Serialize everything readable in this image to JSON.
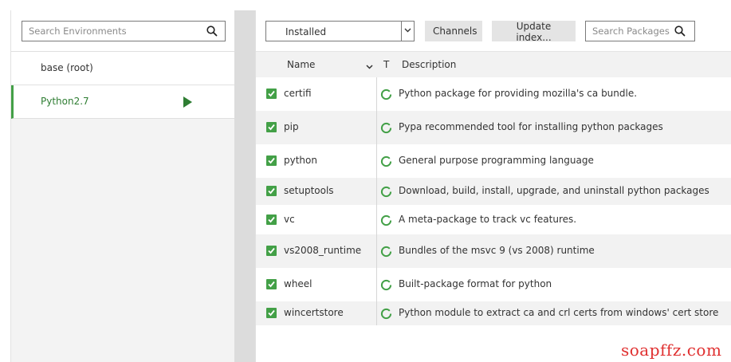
{
  "environments": {
    "search_placeholder": "Search Environments",
    "items": [
      {
        "label": "base (root)",
        "active": false
      },
      {
        "label": "Python2.7",
        "active": true
      }
    ]
  },
  "toolbar": {
    "filter_value": "Installed",
    "channels_label": "Channels",
    "update_label": "Update index...",
    "search_placeholder": "Search Packages"
  },
  "table": {
    "headers": {
      "name": "Name",
      "type": "T",
      "description": "Description"
    },
    "rows": [
      {
        "name": "certifi",
        "description": "Python package for providing mozilla's ca bundle."
      },
      {
        "name": "pip",
        "description": "Pypa recommended tool for installing python packages"
      },
      {
        "name": "python",
        "description": "General purpose programming language"
      },
      {
        "name": "setuptools",
        "description": "Download, build, install, upgrade, and uninstall python packages"
      },
      {
        "name": "vc",
        "description": "A meta-package to track vc features."
      },
      {
        "name": "vs2008_runtime",
        "description": "Bundles of the msvc 9 (vs 2008) runtime"
      },
      {
        "name": "wheel",
        "description": "Built-package format for python"
      },
      {
        "name": "wincertstore",
        "description": "Python module to extract ca and crl certs from windows' cert store"
      }
    ]
  },
  "watermark": "soapffz.com",
  "colors": {
    "accent": "#43a047",
    "active_text": "#2e7d32",
    "button_bg": "#e4e4e4"
  },
  "icons": {
    "search": "search-icon",
    "play": "play-icon",
    "checkbox": "checkbox-checked-icon",
    "status": "package-status-icon",
    "caret": "chevron-down-icon"
  }
}
